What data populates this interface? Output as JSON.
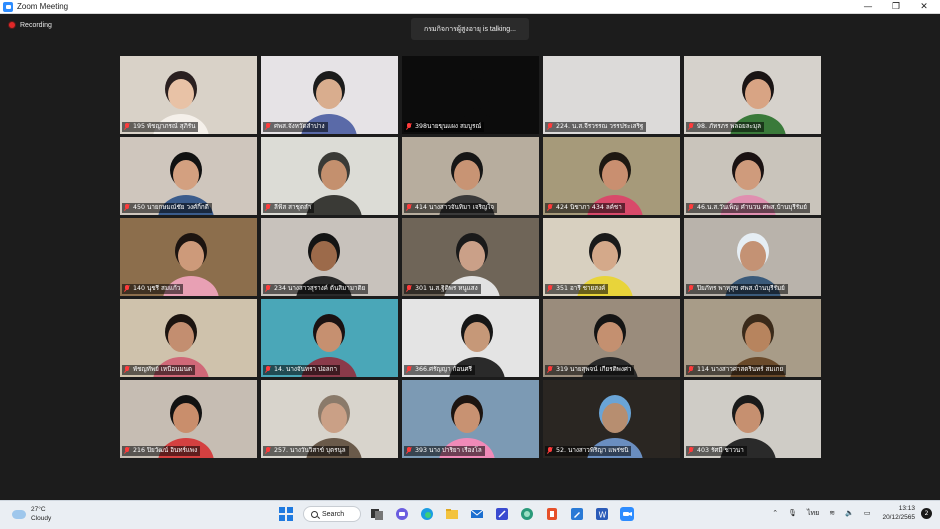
{
  "window": {
    "title": "Zoom Meeting",
    "controls": {
      "minimize": "—",
      "maximize": "❐",
      "close": "✕"
    }
  },
  "recording_label": "Recording",
  "talking_banner": "กรมกิจการผู้สูงอายุ is talking...",
  "participants": [
    {
      "name": "195 พัชญาภรณ์ สุภิรัน",
      "bg": "#d9d2c8",
      "skin": "#e8c2a6",
      "shirt": "#f5f0ea",
      "hair": "#2a2020"
    },
    {
      "name": "ศพส.จังหวัดลำปาง",
      "bg": "#e6e3e6",
      "skin": "#d9ad8e",
      "shirt": "#5a6aa8",
      "hair": "#1c1c1c"
    },
    {
      "name": "398นายขุนแผง สมบูรณ์",
      "bg": "#0c0c0c",
      "skin": "#0c0c0c",
      "shirt": "#0c0c0c",
      "hair": "#0c0c0c"
    },
    {
      "name": "224. น.ส.จีรวรรณ วรรประเสริฐ",
      "bg": "#dcdad9",
      "skin": "#dcdad9",
      "shirt": "#dcdad9",
      "hair": "#dcdad9"
    },
    {
      "name": "98. ภัทรภร พลอยละมุล",
      "bg": "#d6d2cc",
      "skin": "#d8a484",
      "shirt": "#3a7a3a",
      "hair": "#1a1414"
    },
    {
      "name": "450 นายกษมณ์ชัย วงศ์กิ๊กดี",
      "bg": "#cfc6bd",
      "skin": "#d3a080",
      "shirt": "#3b5c8c",
      "hair": "#111111"
    },
    {
      "name": "ลีฟ้ส สาชุตลำ",
      "bg": "#dcdcd6",
      "skin": "#c4906e",
      "shirt": "#3a3a36",
      "hair": "#3a3a36"
    },
    {
      "name": "414 นางสาวจันทิมา เจริญใจ",
      "bg": "#b7ad9e",
      "skin": "#c89474",
      "shirt": "#3a3a3a",
      "hair": "#161616"
    },
    {
      "name": "424 นิชาภา 434 ลค์ชา",
      "bg": "#a69a7a",
      "skin": "#c98f70",
      "shirt": "#d84a6a",
      "hair": "#1e1812"
    },
    {
      "name": "46.น.ส.วันเพ็ญ คำนวน ศพส.บ้านบุรีรัมย์",
      "bg": "#c9c4bb",
      "skin": "#cf9b7c",
      "shirt": "#e08fb0",
      "hair": "#1a1212"
    },
    {
      "name": "140 นุชรี สมแก้ว",
      "bg": "#8c6e4c",
      "skin": "#cd9a7a",
      "shirt": "#e8a0b4",
      "hair": "#1c1410"
    },
    {
      "name": "234 นางสาวสุรางค์ ต้นสิมามาติย",
      "bg": "#c8c2bc",
      "skin": "#9c6a4a",
      "shirt": "#2a2a2a",
      "hair": "#141414"
    },
    {
      "name": "301 น.ส.ฐิติพร หนูแสง",
      "bg": "#6f6558",
      "skin": "#caa088",
      "shirt": "#e2e2e2",
      "hair": "#1a1a1a"
    },
    {
      "name": "351 อารี ชายสงค์",
      "bg": "#d8d0c0",
      "skin": "#d4a98a",
      "shirt": "#e8d43a",
      "hair": "#1a1a1a"
    },
    {
      "name": "ปิยภัทร พาหุสุข ศพส.บ้านบุรีรัมย์",
      "bg": "#b9b3ab",
      "skin": "#c49274",
      "shirt": "#3a5a7a",
      "hair": "#e6eef4"
    },
    {
      "name": "พัชญทัพย์ เหนือนมนต",
      "bg": "#cfc2ac",
      "skin": "#c38e70",
      "shirt": "#d06878",
      "hair": "#1c1410"
    },
    {
      "name": "14. นางจันทรา ปอลกา",
      "bg": "#4aa7b8",
      "skin": "#c69070",
      "shirt": "#8a3a4a",
      "hair": "#1a1212"
    },
    {
      "name": "366.ศรัญญา ก้อนศรี",
      "bg": "#e4e4e4",
      "skin": "#c69878",
      "shirt": "#2a2a2a",
      "hair": "#161616"
    },
    {
      "name": "319 นายสุพจน์ เกียรติพงศา",
      "bg": "#9a8c7c",
      "skin": "#c49070",
      "shirt": "#2a2a2a",
      "hair": "#141414"
    },
    {
      "name": "114 นางสาวศาสตรินทร์ สมเกย",
      "bg": "#a89c88",
      "skin": "#b7845e",
      "shirt": "#6a4a2a",
      "hair": "#3a2a1a"
    },
    {
      "name": "216 ปิยวัฒน์ อินทร์แพง",
      "bg": "#c6bdb3",
      "skin": "#c98e6c",
      "shirt": "#d44040",
      "hair": "#121212"
    },
    {
      "name": "257. นางวันวิสาข์ บุตรนุล",
      "bg": "#d8d4cc",
      "skin": "#caa086",
      "shirt": "#6a5a4a",
      "hair": "#8a7a6a"
    },
    {
      "name": "393 นาง ปาริยา เรืองโล",
      "bg": "#7c9ab4",
      "skin": "#c89272",
      "shirt": "#f08ab8",
      "hair": "#1c1410"
    },
    {
      "name": "52. นางสาวพิริญา แพร่ชนิ",
      "bg": "#2a2622",
      "skin": "#b78e70",
      "shirt": "#6a8ec0",
      "hair": "#6aa4d6"
    },
    {
      "name": "403 รัศมี ชาวนา",
      "bg": "#cfccc6",
      "skin": "#c69070",
      "shirt": "#2a2a2a",
      "hair": "#1a1a1a"
    }
  ],
  "taskbar": {
    "weather_temp": "27°C",
    "weather_desc": "Cloudy",
    "search_label": "Search",
    "language": "ไทย",
    "time": "13:13",
    "date": "20/12/2565",
    "notifications": "2"
  },
  "taskbar_icons": [
    "start-icon",
    "task-view-icon",
    "chat-icon",
    "edge-icon",
    "file-explorer-icon",
    "mail-icon",
    "app-icon",
    "edge-icon-2",
    "office-icon",
    "pen-icon",
    "word-icon",
    "zoom-icon"
  ]
}
